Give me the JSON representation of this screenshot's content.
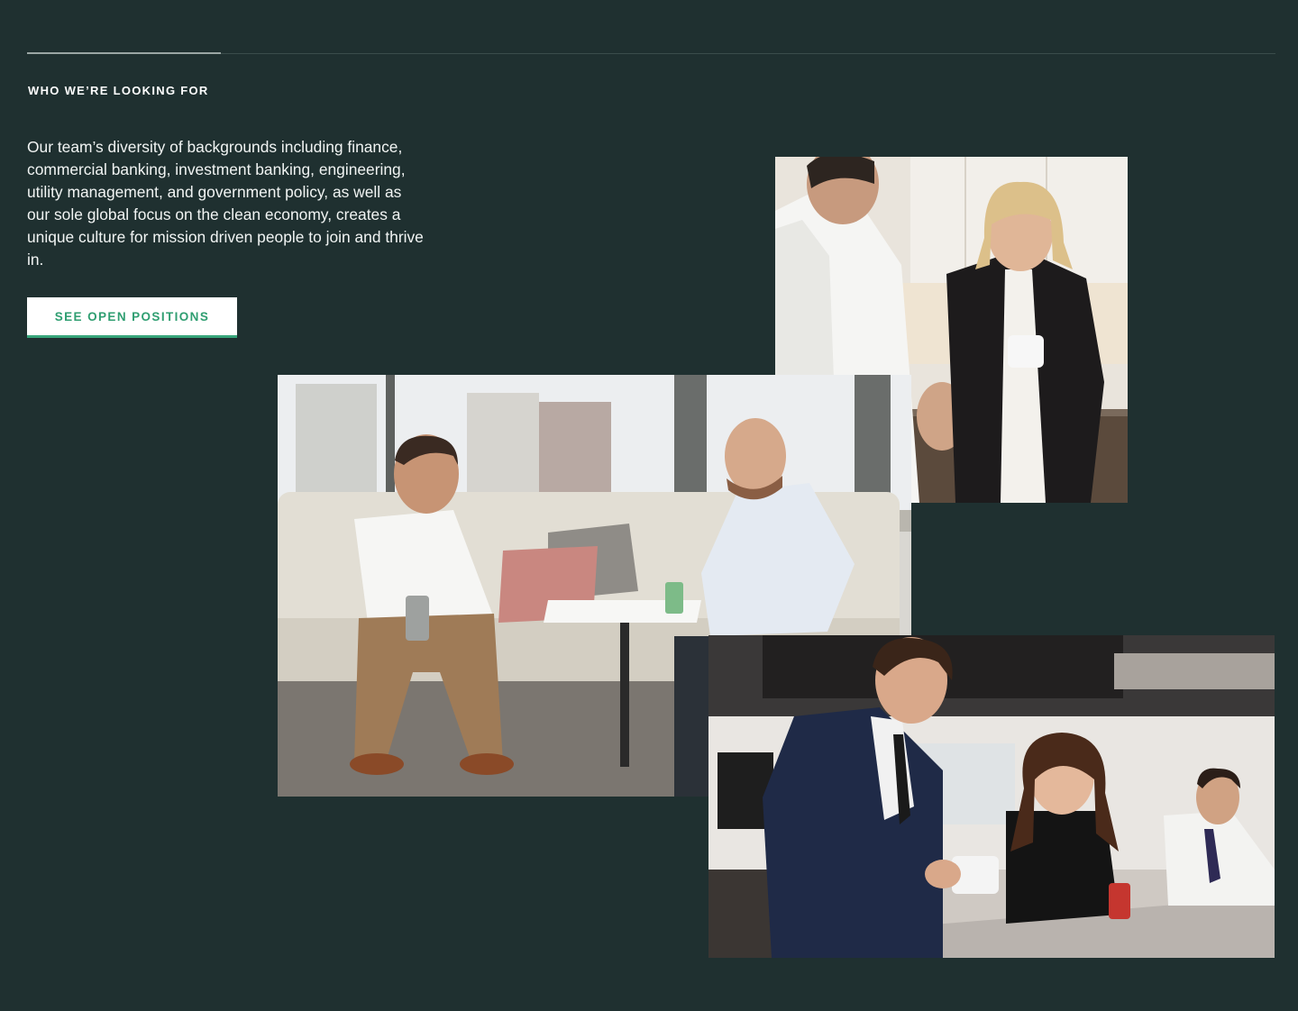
{
  "section": {
    "eyebrow": "WHO WE’RE LOOKING FOR",
    "body": "Our team’s diversity of backgrounds including finance, commercial banking, investment banking, engineering, utility management, and government policy, as well as our sole global focus on the clean economy, creates a unique culture for mission driven people to join and thrive in.",
    "cta_label": "SEE OPEN POSITIONS"
  },
  "colors": {
    "background": "#1f3030",
    "accent": "#2f9e71",
    "text": "#ffffff"
  }
}
